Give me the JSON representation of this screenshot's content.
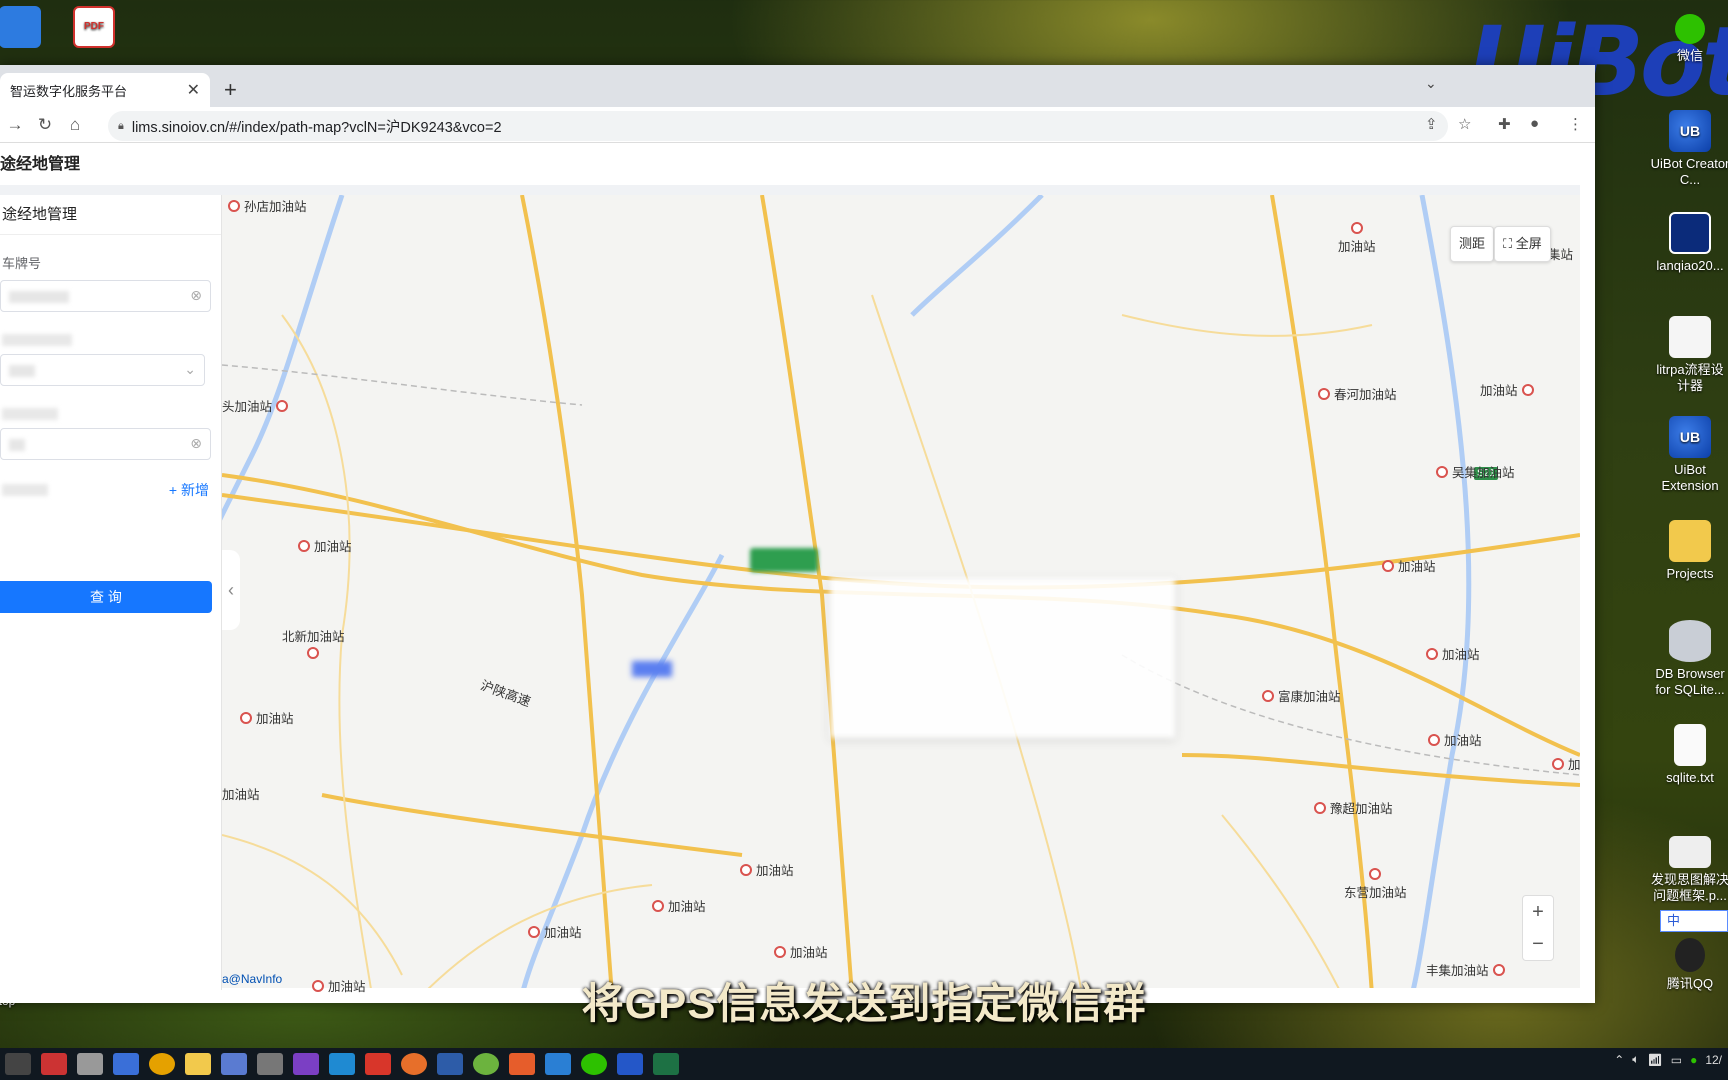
{
  "desktop": {
    "icons_left": [
      {
        "label": "",
        "icon": "blue-app-icon"
      },
      {
        "label": "",
        "icon": "pdf-icon",
        "badge": "PDF"
      }
    ],
    "icons_right": [
      {
        "label": "微信",
        "icon": "wechat-icon"
      },
      {
        "label": "UiBot Creator C...",
        "icon": "uibot-icon",
        "glyph": "UB"
      },
      {
        "label": "lanqiao20...",
        "icon": "lanqiao-icon"
      },
      {
        "label": "litrpa流程设计器",
        "icon": "flowchart-icon"
      },
      {
        "label": "UiBot Extension",
        "icon": "uibot-extension-icon",
        "glyph": "UB"
      },
      {
        "label": "Projects",
        "icon": "folder-icon"
      },
      {
        "label": "DB Browser for SQLite...",
        "icon": "database-icon"
      },
      {
        "label": "sqlite.txt",
        "icon": "text-file-icon"
      },
      {
        "label": "发现思图解决问题框架.p...",
        "icon": "image-file-icon"
      },
      {
        "label": "腾讯QQ",
        "icon": "qq-icon"
      }
    ],
    "desktop_label": "esktop",
    "uibot_logo": "UiBot"
  },
  "browser": {
    "tab_title": "智运数字化服务平台",
    "url": "lims.sinoiov.cn/#/index/path-map?vclN=沪DK9243&vco=2"
  },
  "page": {
    "header": "途经地管理",
    "panel": {
      "title": "途经地管理",
      "plate_label": "车牌号",
      "add_label": "+ 新增",
      "query_label": "查 询"
    },
    "map": {
      "measure_button": "测距",
      "fullscreen_button": "全屏",
      "zoom_in": "+",
      "zoom_out": "−",
      "credit": "a@NavInfo",
      "highway_label": "沪陕高速",
      "shield_label": "S21",
      "pois": [
        {
          "label": "孙店加油站"
        },
        {
          "label": "加油站"
        },
        {
          "label": "头加油站"
        },
        {
          "label": "加油站"
        },
        {
          "label": "北新加油站"
        },
        {
          "label": "加油站"
        },
        {
          "label": "加油站"
        },
        {
          "label": "加油站"
        },
        {
          "label": "加油站"
        },
        {
          "label": "加油站"
        },
        {
          "label": "加油站"
        },
        {
          "label": "加油站"
        },
        {
          "label": "春河加油站"
        },
        {
          "label": "加油站"
        },
        {
          "label": "吴集加油站"
        },
        {
          "label": "加油站"
        },
        {
          "label": "加油站"
        },
        {
          "label": "富康加油站"
        },
        {
          "label": "加油站"
        },
        {
          "label": "豫超加油站"
        },
        {
          "label": "东营加油站"
        },
        {
          "label": "丰集加油站"
        },
        {
          "label": "集站"
        },
        {
          "label": "加"
        }
      ]
    }
  },
  "subtitle": "将GPS信息发送到指定微信群",
  "ime": {
    "label": "中"
  },
  "colors": {
    "accent": "#1677ff",
    "road": "#f2c14e",
    "river": "#a9c9f5"
  }
}
